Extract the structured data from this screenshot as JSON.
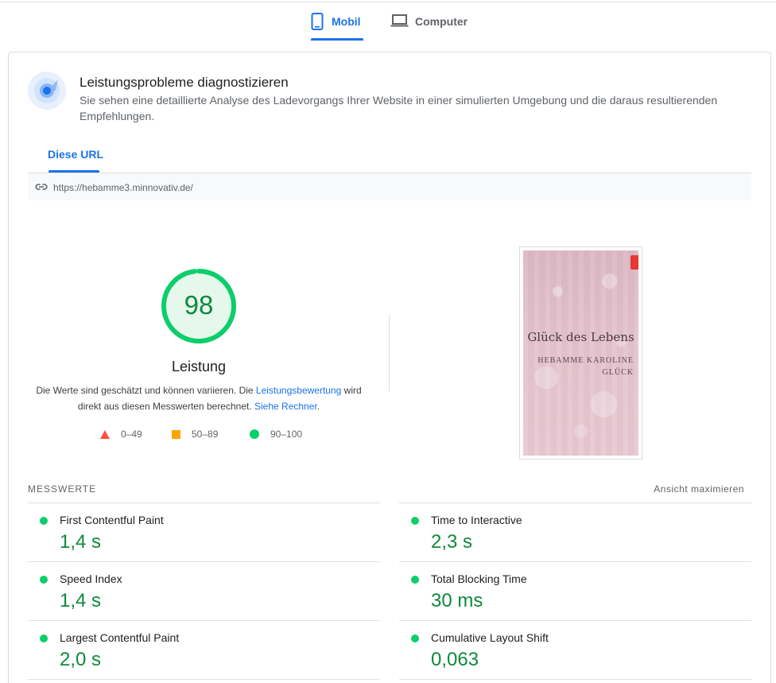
{
  "device_tabs": {
    "mobile_label": "Mobil",
    "desktop_label": "Computer",
    "active": "mobile"
  },
  "diagnose": {
    "title": "Leistungsprobleme diagnostizieren",
    "description": "Sie sehen eine detaillierte Analyse des Ladevorgangs Ihrer Website in einer simulierten Umgebung und die daraus resultierenden Empfehlungen.",
    "icon": "gauge-icon"
  },
  "url_tab": {
    "label": "Diese URL",
    "url": "https://hebamme3.minnovativ.de/",
    "icon": "link-icon"
  },
  "score": {
    "value": 98,
    "display": "98",
    "fraction": 0.98,
    "label": "Leistung",
    "desc_part1": "Die Werte sind geschätzt und können variieren. Die ",
    "desc_link1": "Leistungsbewertung",
    "desc_part2": " wird direkt aus diesen Messwerten berechnet. ",
    "desc_link2": "Siehe Rechner",
    "desc_part3": "."
  },
  "legend": [
    {
      "shape": "triangle",
      "label": "0–49",
      "color": "#ff4e42"
    },
    {
      "shape": "square",
      "label": "50–89",
      "color": "#ffa400"
    },
    {
      "shape": "circle",
      "label": "90–100",
      "color": "#0cce6b"
    }
  ],
  "screenshot": {
    "title": "Glück des Lebens",
    "subtitle": "HEBAMME KAROLINE GLÜCK"
  },
  "metrics": {
    "title": "MESSWERTE",
    "expand_label": "Ansicht maximieren",
    "items": [
      {
        "name": "First Contentful Paint",
        "value": "1,4 s"
      },
      {
        "name": "Time to Interactive",
        "value": "2,3 s"
      },
      {
        "name": "Speed Index",
        "value": "1,4 s"
      },
      {
        "name": "Total Blocking Time",
        "value": "30 ms"
      },
      {
        "name": "Largest Contentful Paint",
        "value": "2,0 s"
      },
      {
        "name": "Cumulative Layout Shift",
        "value": "0,063"
      }
    ]
  },
  "colors": {
    "accent": "#1a73e8",
    "pass": "#0cce6b",
    "pass_text": "#0d8a3b",
    "average": "#ffa400",
    "fail": "#ff4e42"
  }
}
